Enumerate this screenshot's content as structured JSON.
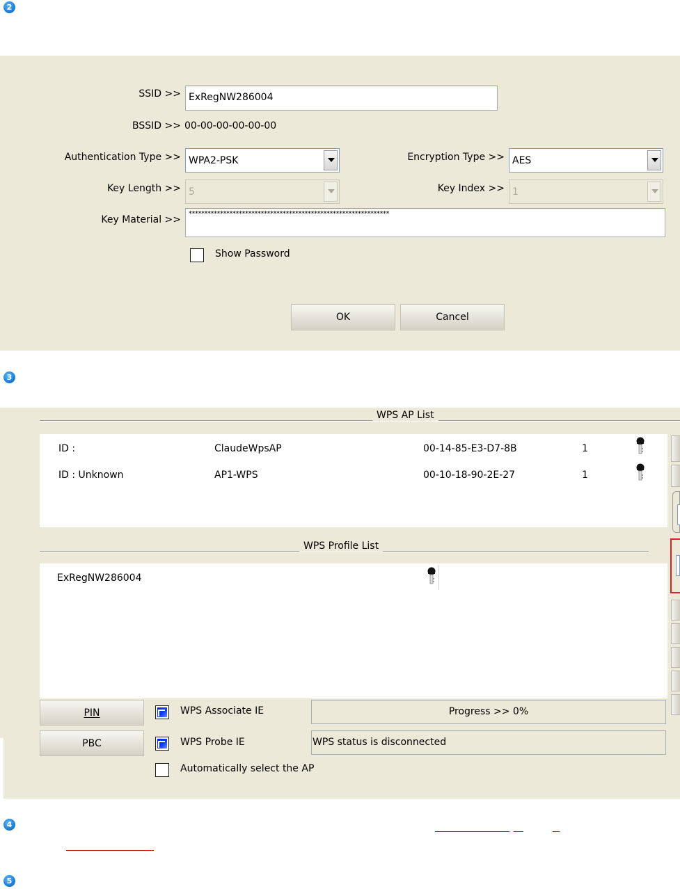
{
  "steps": [
    "2",
    "3",
    "4",
    "5"
  ],
  "profile_dialog": {
    "ssid_label": "SSID >>",
    "ssid_value": "ExRegNW286004",
    "bssid_label": "BSSID >>",
    "bssid_value": "00-00-00-00-00-00",
    "auth_label": "Authentication Type >>",
    "auth_value": "WPA2-PSK",
    "enc_label": "Encryption Type >>",
    "enc_value": "AES",
    "keylen_label": "Key Length >>",
    "keylen_value": "5",
    "keyidx_label": "Key Index >>",
    "keyidx_value": "1",
    "keymat_label": "Key Material >>",
    "keymat_value": "****************************************************************",
    "show_password_label": "Show Password",
    "ok_label": "OK",
    "cancel_label": "Cancel"
  },
  "wps": {
    "ap_list_title": "WPS AP List",
    "ap_rows": [
      {
        "id": "ID :",
        "name": "ClaudeWpsAP",
        "bssid": "00-14-85-E3-D7-8B",
        "channel": "1"
      },
      {
        "id": "ID : Unknown",
        "name": "AP1-WPS",
        "bssid": "00-10-18-90-2E-27",
        "channel": "1"
      }
    ],
    "profile_list_title": "WPS Profile List",
    "profile_rows": [
      {
        "name": "ExRegNW286004"
      }
    ],
    "pin_label": "PIN",
    "pbc_label": "PBC",
    "assoc_ie_label": "WPS Associate IE",
    "probe_ie_label": "WPS Probe IE",
    "auto_select_label": "Automatically select the AP",
    "progress_text": "Progress >> 0%",
    "status_text": "WPS status is disconnected"
  },
  "colors": {
    "panel_bg": "#ece9d8",
    "step_bullet": "#1e7fd6",
    "highlight_box": "#e02020",
    "checkbox_checked": "#0a3bff"
  }
}
